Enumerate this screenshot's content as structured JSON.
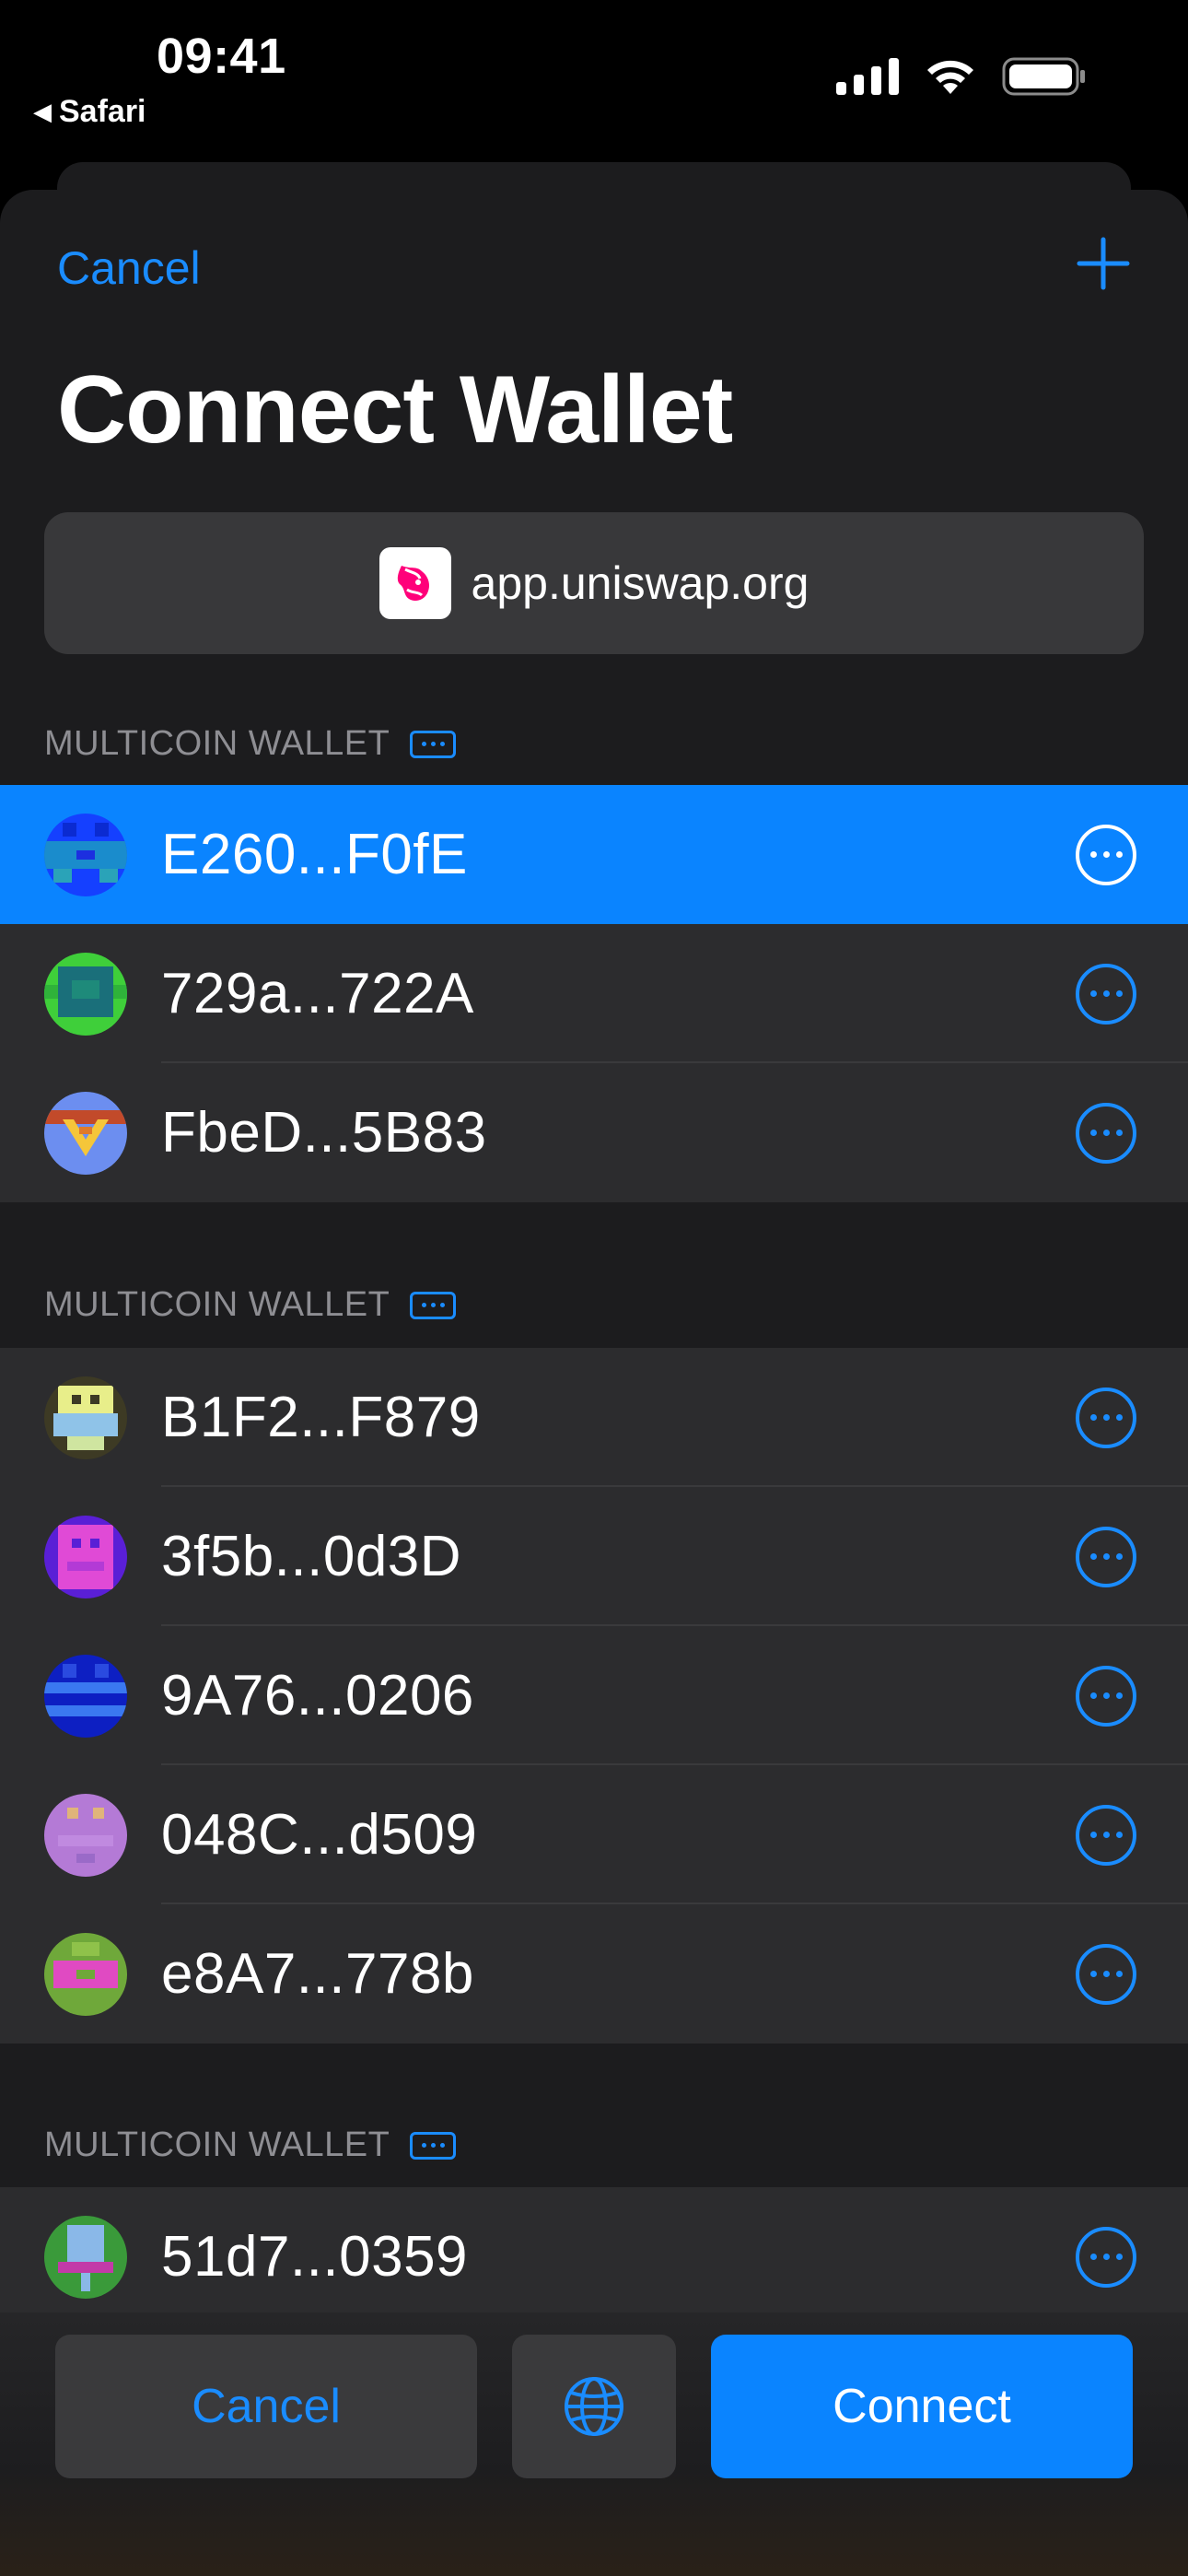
{
  "status_bar": {
    "time": "09:41",
    "back_app": "Safari"
  },
  "sheet": {
    "cancel_label": "Cancel",
    "title": "Connect Wallet",
    "site": "app.uniswap.org"
  },
  "colors": {
    "accent": "#0a84ff",
    "selected_row": "#0a84ff",
    "sheet_bg": "#1c1c1e",
    "row_bg": "#2c2c2e"
  },
  "groups": [
    {
      "header": "MULTICOIN WALLET",
      "accounts": [
        {
          "address": "E260...F0fE",
          "selected": true
        },
        {
          "address": "729a...722A",
          "selected": false
        },
        {
          "address": "FbeD...5B83",
          "selected": false
        }
      ]
    },
    {
      "header": "MULTICOIN WALLET",
      "accounts": [
        {
          "address": "B1F2...F879",
          "selected": false
        },
        {
          "address": "3f5b...0d3D",
          "selected": false
        },
        {
          "address": "9A76...0206",
          "selected": false
        },
        {
          "address": "048C...d509",
          "selected": false
        },
        {
          "address": "e8A7...778b",
          "selected": false
        }
      ]
    },
    {
      "header": "MULTICOIN WALLET",
      "accounts": [
        {
          "address": "51d7...0359",
          "selected": false
        }
      ]
    }
  ],
  "bottom_bar": {
    "cancel_label": "Cancel",
    "connect_label": "Connect",
    "globe_icon": "globe-icon"
  }
}
